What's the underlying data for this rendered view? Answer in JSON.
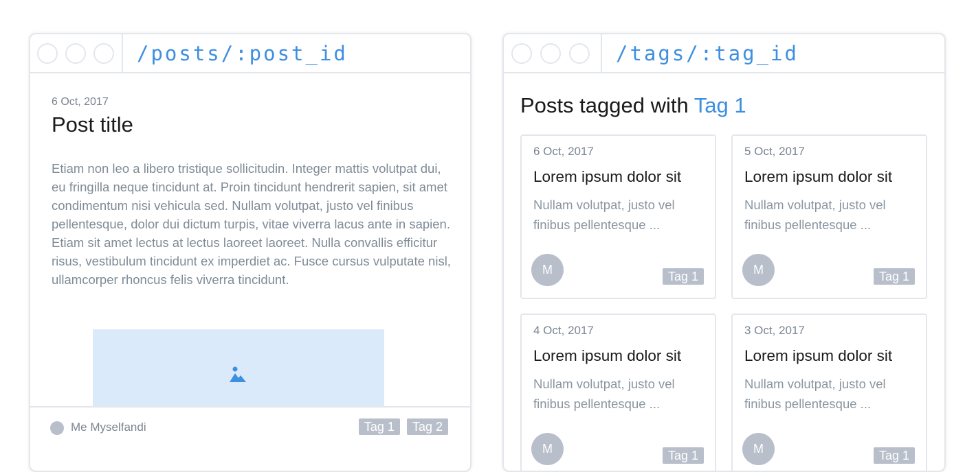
{
  "post_window": {
    "url": "/posts/:post_id",
    "date": "6 Oct, 2017",
    "title": "Post title",
    "body": "Etiam non leo a libero tristique sollicitudin. Integer mattis volutpat dui, eu fringilla neque tincidunt at. Proin tincidunt hendrerit sapien, sit amet condimentum nisi vehicula sed. Nullam volutpat, justo vel finibus pellentesque, dolor dui dictum turpis, vitae viverra lacus ante in sapien. Etiam sit amet lectus at lectus laoreet laoreet. Nulla convallis efficitur risus, vestibulum tincidunt ex imperdiet ac. Fusce cursus vulputate nisl, ullamcorper rhoncus felis viverra tincidunt.",
    "image_icon": "image-placeholder-icon",
    "author": "Me Myselfandi",
    "tags": [
      "Tag 1",
      "Tag 2"
    ]
  },
  "tag_window": {
    "url": "/tags/:tag_id",
    "heading_prefix": "Posts tagged with",
    "heading_tag": "Tag 1",
    "cards": [
      {
        "date": "6 Oct, 2017",
        "title": "Lorem ipsum dolor sit",
        "excerpt": "Nullam volutpat, justo vel finibus pellentesque ...",
        "avatar": "M",
        "tag": "Tag 1"
      },
      {
        "date": "5 Oct, 2017",
        "title": "Lorem ipsum dolor sit",
        "excerpt": "Nullam volutpat, justo vel finibus pellentesque ...",
        "avatar": "M",
        "tag": "Tag 1"
      },
      {
        "date": "4 Oct, 2017",
        "title": "Lorem ipsum dolor sit",
        "excerpt": "Nullam volutpat, justo vel finibus pellentesque ...",
        "avatar": "M",
        "tag": "Tag 1"
      },
      {
        "date": "3 Oct, 2017",
        "title": "Lorem ipsum dolor sit",
        "excerpt": "Nullam volutpat, justo vel finibus pellentesque ...",
        "avatar": "M",
        "tag": "Tag 1"
      }
    ]
  },
  "colors": {
    "accent": "#3d8fe0",
    "border": "#e3e6eb",
    "tag_bg": "#b8bfcb",
    "image_bg": "#dbeafa"
  }
}
